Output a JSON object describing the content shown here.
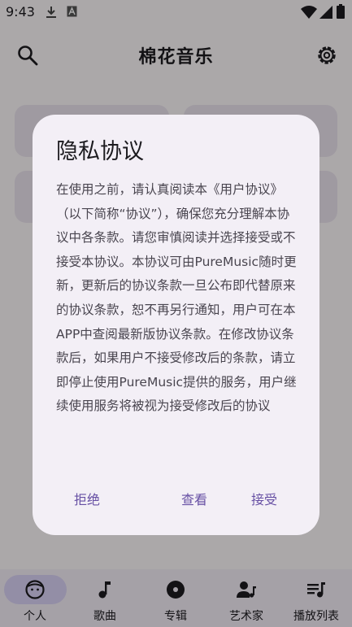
{
  "status": {
    "time": "9:43"
  },
  "app": {
    "title": "棉花音乐"
  },
  "nav": {
    "items": [
      {
        "label": "个人",
        "icon": "person-face-icon",
        "active": true
      },
      {
        "label": "歌曲",
        "icon": "music-note-icon",
        "active": false
      },
      {
        "label": "专辑",
        "icon": "album-disc-icon",
        "active": false
      },
      {
        "label": "艺术家",
        "icon": "artist-icon",
        "active": false
      },
      {
        "label": "播放列表",
        "icon": "playlist-icon",
        "active": false
      }
    ]
  },
  "dialog": {
    "title": "隐私协议",
    "body": "在使用之前，请认真阅读本《用户协议》（以下简称“协议”），确保您充分理解本协议中各条款。请您审慎阅读并选择接受或不接受本协议。本协议可由PureMusic随时更新，更新后的协议条款一旦公布即代替原来的协议条款，恕不再另行通知，用户可在本APP中查阅最新版协议条款。在修改协议条款后，如果用户不接受修改后的条款，请立即停止使用PureMusic提供的服务，用户继续使用服务将被视为接受修改后的协议",
    "reject_label": "拒绝",
    "view_label": "查看",
    "accept_label": "接受"
  },
  "colors": {
    "accent": "#6750a4",
    "dialog_bg": "#f3eff6",
    "nav_bg": "#f3edf7",
    "nav_pill": "#d9d2f5"
  }
}
